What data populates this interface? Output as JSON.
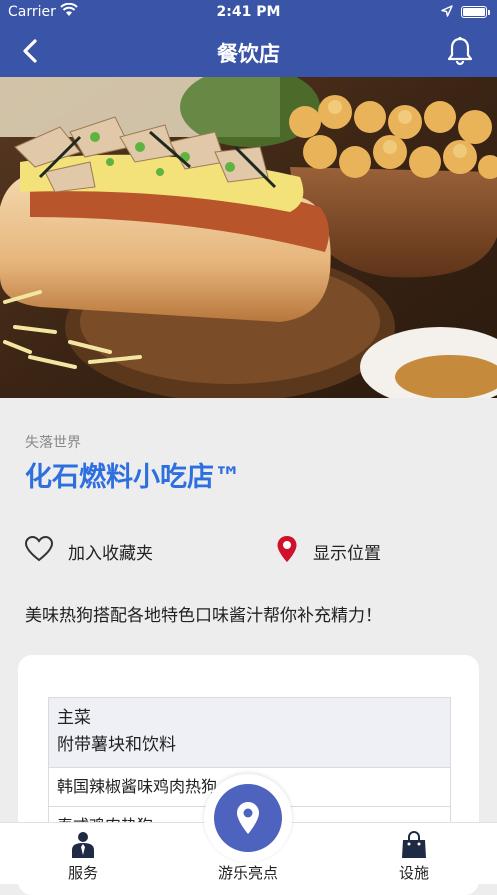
{
  "status_bar": {
    "carrier": "Carrier",
    "time": "2:41 PM"
  },
  "nav": {
    "title": "餐饮店"
  },
  "hero": {
    "alt": "hot-dog-photo"
  },
  "detail": {
    "category": "失落世界",
    "name": "化石燃料小吃店™",
    "favorite_label": "加入收藏夹",
    "location_label": "显示位置",
    "description": "美味热狗搭配各地特色口味酱汁帮你补充精力！"
  },
  "menu": {
    "header_line1": "主菜",
    "header_line2": "附带薯块和饮料",
    "items": [
      "韩国辣椒酱味鸡肉热狗",
      "泰式鸡肉热狗"
    ]
  },
  "tabs": {
    "services": "服务",
    "highlights": "游乐亮点",
    "facilities": "设施"
  },
  "colors": {
    "brand": "#3a55a8",
    "accent": "#2e6fe0",
    "pin": "#d0112b",
    "fab": "#4e63be"
  }
}
